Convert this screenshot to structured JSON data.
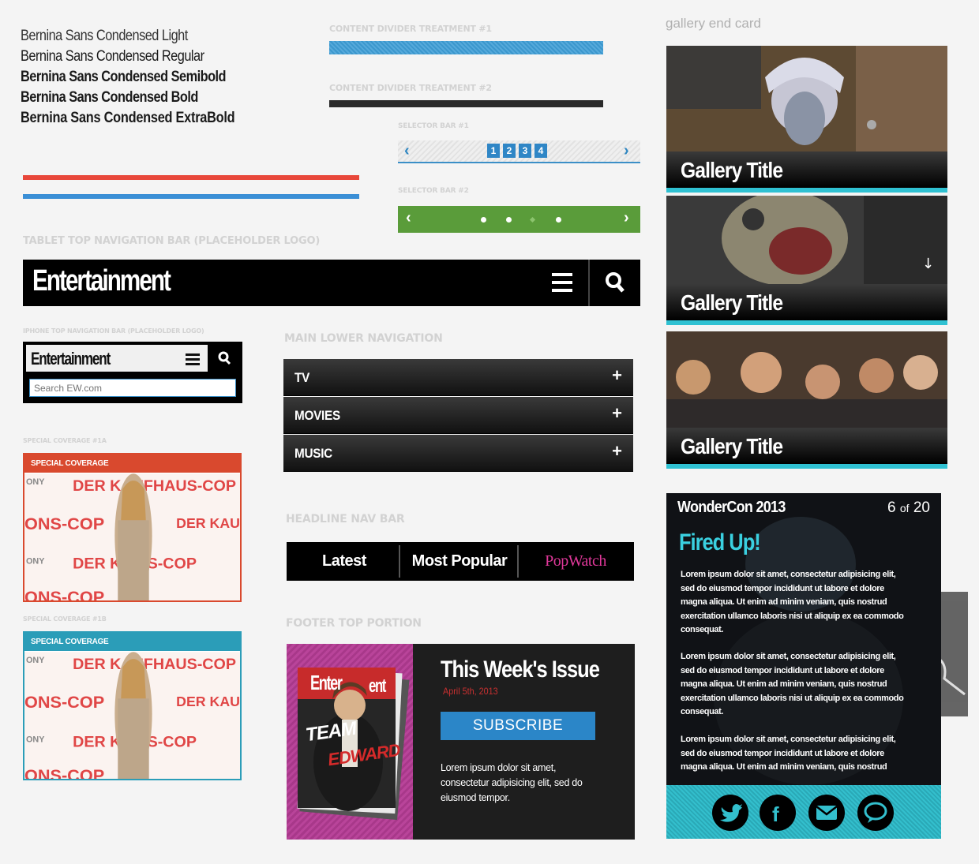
{
  "fonts": [
    "Bernina Sans Condensed Light",
    "Bernina Sans Condensed Regular",
    "Bernina Sans Condensed Semibold",
    "Bernina Sans Condensed Bold",
    "Bernina Sans Condensed ExtraBold"
  ],
  "labels": {
    "divider1": "CONTENT DIVIDER TREATMENT #1",
    "divider2": "CONTENT DIVIDER TREATMENT #2",
    "selector1": "SELECTOR BAR #1",
    "selector2": "SELECTOR BAR #2",
    "tablet_nav": "TABLET TOP NAVIGATION BAR (PLACEHOLDER LOGO)",
    "iphone_nav": "IPHONE TOP NAVIGATION BAR (PLACEHOLDER LOGO)",
    "main_lower_nav": "MAIN LOWER NAVIGATION",
    "headline_nav": "HEADLINE NAV BAR",
    "footer_top": "FOOTER TOP PORTION",
    "special_1a": "SPECIAL COVERAGE #1A",
    "special_1b": "SPECIAL COVERAGE #1B",
    "gallery_end": "gallery end card"
  },
  "colors": {
    "red_line": "#e8473a",
    "blue_line": "#3b8fd6",
    "accent_blue": "#2f86c6",
    "accent_green": "#5a9c3a",
    "accent_cyan": "#2fc1d2",
    "special_red": "#d9492e",
    "special_teal": "#2b9db8",
    "popwatch_pink": "#e0389a"
  },
  "selector1": {
    "prev": "‹",
    "next": "›",
    "pages": [
      "1",
      "2",
      "3",
      "4"
    ]
  },
  "selector2": {
    "prev": "‹",
    "next": "›",
    "dots": 4,
    "active_dot": 3
  },
  "tablet_nav": {
    "logo": "Entertainment",
    "menu_icon": "hamburger-icon",
    "search_icon": "search-icon"
  },
  "iphone_nav": {
    "logo": "Entertainment",
    "search_placeholder": "Search EW.com"
  },
  "special": [
    {
      "header": "SPECIAL COVERAGE",
      "color": "#d9492e"
    },
    {
      "header": "SPECIAL COVERAGE",
      "color": "#2b9db8"
    }
  ],
  "backdrop_text": [
    "ONY",
    "DER KAUFHAUS-COP",
    "ONS-COP",
    "DER KAUF"
  ],
  "lower_nav": [
    {
      "label": "TV",
      "icon": "+"
    },
    {
      "label": "MOVIES",
      "icon": "+"
    },
    {
      "label": "MUSIC",
      "icon": "+"
    }
  ],
  "headline_nav": [
    {
      "label": "Latest"
    },
    {
      "label": "Most Popular"
    },
    {
      "label": "PopWatch"
    }
  ],
  "footer": {
    "title": "This Week's Issue",
    "date": "April 5th, 2013",
    "subscribe": "SUBSCRIBE",
    "body": "Lorem ipsum dolor sit amet, consectetur adipisicing elit, sed do eiusmod tempor.",
    "mag_words": [
      "Enter",
      "ent",
      "TEAM",
      "EDWARD"
    ]
  },
  "gallery": [
    {
      "title": "Gallery Title"
    },
    {
      "title": "Gallery Title"
    },
    {
      "title": "Gallery Title"
    }
  ],
  "wondercon": {
    "event": "WonderCon 2013",
    "counter_current": "6",
    "counter_of": "of",
    "counter_total": "20",
    "headline": "Fired Up!",
    "p1": "Lorem ipsum dolor sit amet, consectetur adipisicing elit, sed do eiusmod tempor incididunt ut labore et dolore magna aliqua. Ut enim ad minim veniam, quis nostrud exercitation ullamco laboris nisi ut aliquip ex ea commodo consequat.",
    "p2": "Lorem ipsum dolor sit amet, consectetur adipisicing elit, sed do eiusmod tempor incididunt ut labore et dolore magna aliqua. Ut enim ad minim veniam, quis nostrud exercitation ullamco laboris nisi ut aliquip ex ea commodo consequat.",
    "p3": "Lorem ipsum dolor sit amet, consectetur adipisicing elit, sed do eiusmod tempor incididunt ut labore et dolore magna aliqua. Ut enim ad minim veniam, quis nostrud",
    "social": [
      "twitter-icon",
      "facebook-icon",
      "mail-icon",
      "comment-icon"
    ]
  }
}
